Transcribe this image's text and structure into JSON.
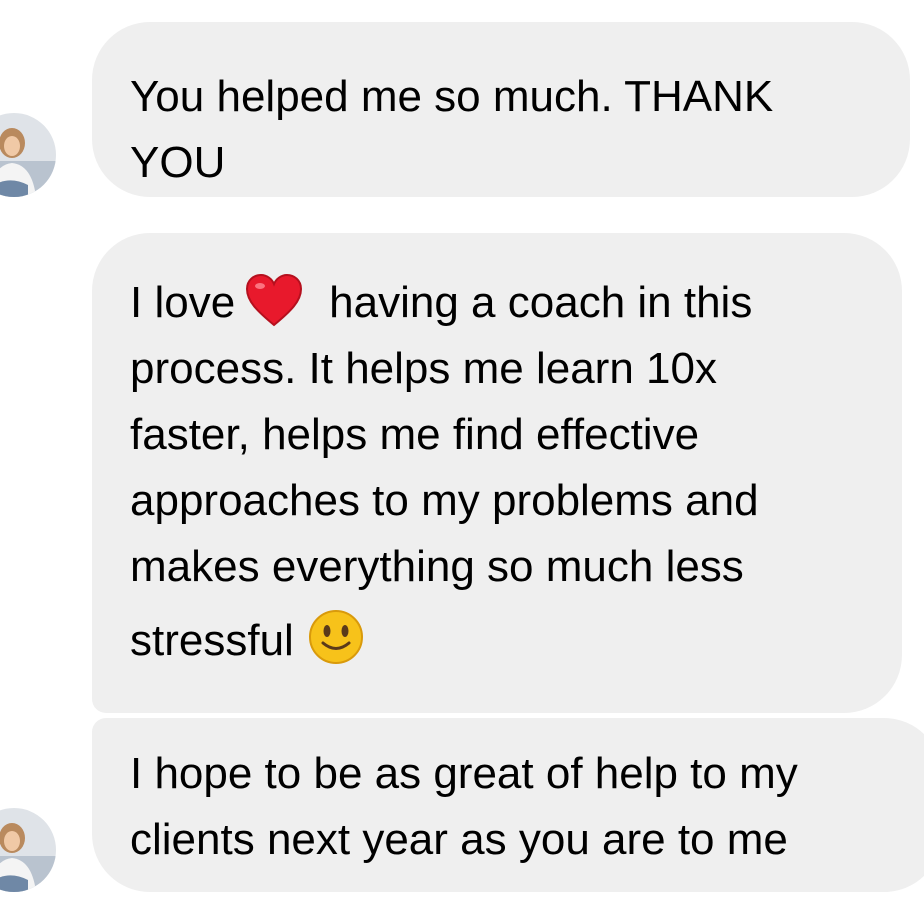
{
  "messages": [
    {
      "lines": [
        "You helped me so much. THANK",
        "YOU"
      ]
    },
    {
      "line1_before": "I love",
      "line1_emoji": "red-heart",
      "line1_after": "having a coach in this",
      "lines": [
        "process. It helps me learn 10x",
        "faster, helps me find effective",
        "approaches to my problems and",
        "makes everything so much less"
      ],
      "last_text": "stressful",
      "last_emoji": "slightly-smiling-face"
    },
    {
      "lines": [
        "I hope to be as great of help to my",
        "clients next year as you are to me"
      ]
    }
  ],
  "colors": {
    "bubble": "#efefef",
    "text": "#000000",
    "heart": "#e8192c",
    "smile": "#f7c21a"
  },
  "avatar": {
    "icon": "user-avatar"
  }
}
